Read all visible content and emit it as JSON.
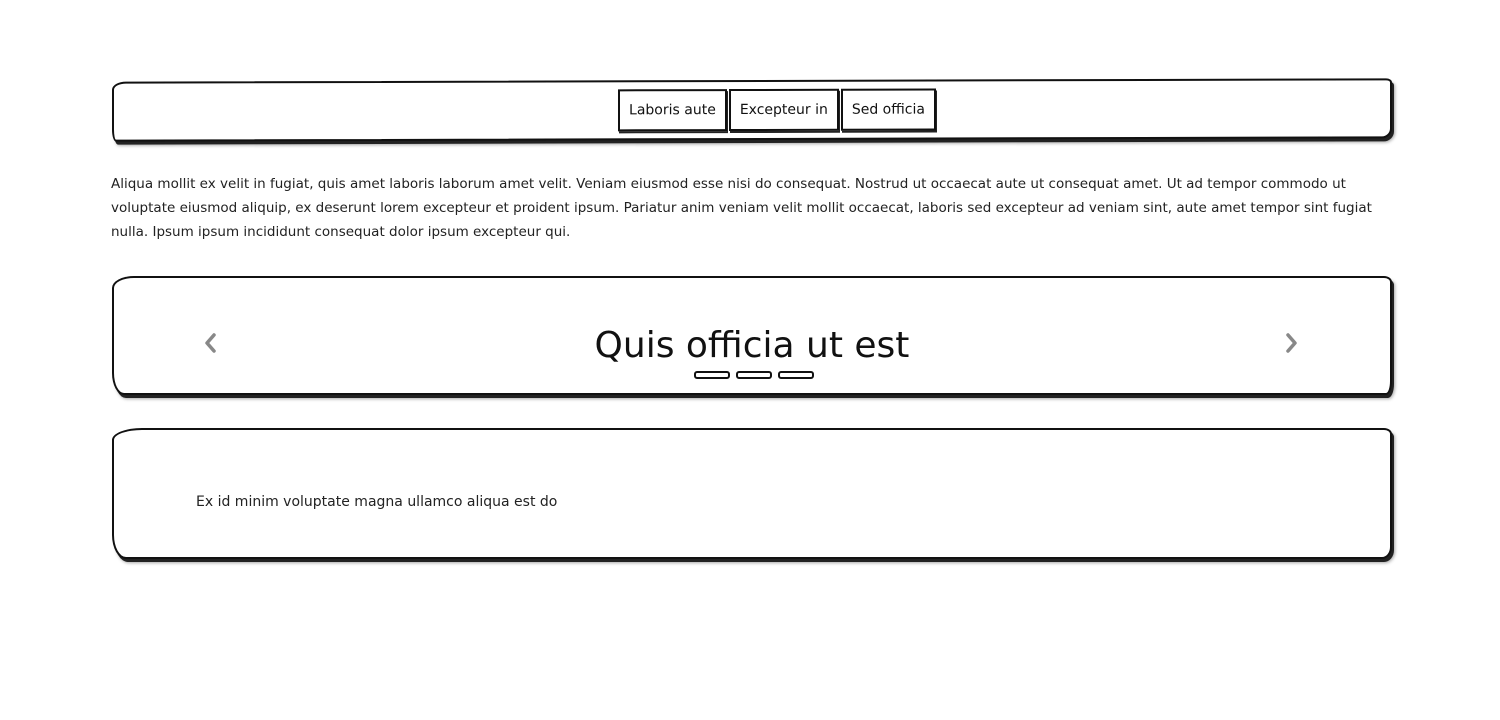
{
  "nav": {
    "items": [
      {
        "label": "Laboris aute"
      },
      {
        "label": "Excepteur in"
      },
      {
        "label": "Sed officia"
      }
    ]
  },
  "intro": {
    "text": "Aliqua mollit ex velit in fugiat, quis amet laboris laborum amet velit. Veniam eiusmod esse nisi do consequat. Nostrud ut occaecat aute ut consequat amet. Ut ad tempor commodo ut voluptate eiusmod aliquip, ex deserunt lorem excepteur et proident ipsum. Pariatur anim veniam velit mollit occaecat, laboris sed excepteur ad veniam sint, aute amet tempor sint fugiat nulla. Ipsum ipsum incididunt consequat dolor ipsum excepteur qui."
  },
  "carousel": {
    "slide_title": "Quis officia ut est",
    "prev_icon": "chevron-left-icon",
    "next_icon": "chevron-right-icon",
    "slide_count": 3,
    "arrow_color": "#888888"
  },
  "card": {
    "text": "Ex id minim voluptate magna ullamco aliqua est do"
  }
}
